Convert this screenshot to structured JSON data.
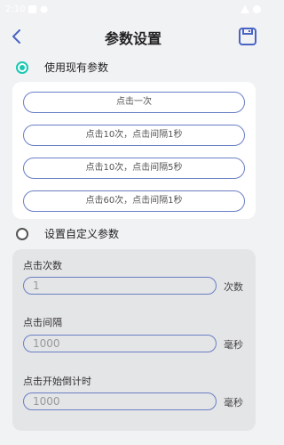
{
  "status": {
    "time": "2:10"
  },
  "header": {
    "title": "参数设置"
  },
  "preset": {
    "label": "使用现有参数",
    "selected": true,
    "buttons": [
      "点击一次",
      "点击10次，点击间隔1秒",
      "点击10次，点击间隔5秒",
      "点击60次，点击间隔1秒"
    ]
  },
  "custom": {
    "label": "设置自定义参数",
    "selected": false,
    "fields": [
      {
        "label": "点击次数",
        "placeholder": "1",
        "unit": "次数"
      },
      {
        "label": "点击间隔",
        "placeholder": "1000",
        "unit": "毫秒"
      },
      {
        "label": "点击开始倒计时",
        "placeholder": "1000",
        "unit": "毫秒"
      }
    ]
  },
  "colors": {
    "accent": "#19c8b3",
    "primary": "#4a64c4",
    "border": "#6a7fc4"
  }
}
